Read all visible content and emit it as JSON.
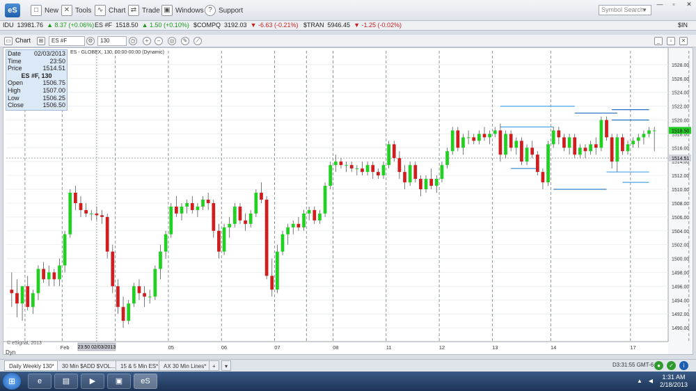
{
  "app": {
    "logo": "eS"
  },
  "menu": {
    "new": "New",
    "tools": "Tools",
    "chart": "Chart",
    "trade": "Trade",
    "windows": "Windows",
    "support": "Support",
    "search_placeholder": "Symbol Search"
  },
  "ticker": [
    {
      "symbol": "IDU",
      "price": "13981.76",
      "change": "8.37 (+0.06%)",
      "dir": "up"
    },
    {
      "symbol": "ES #F",
      "price": "1518.50",
      "change": "1.50 (+0.10%)",
      "dir": "up"
    },
    {
      "symbol": "$COMPQ",
      "price": "3192.03",
      "change": "-6.63 (-0.21%)",
      "dir": "down"
    },
    {
      "symbol": "$TRAN",
      "price": "5946.45",
      "change": "-1.25 (-0.02%)",
      "dir": "down"
    },
    {
      "symbol": "$IN",
      "price": "",
      "change": "",
      "dir": ""
    }
  ],
  "chart_toolbar": {
    "chart_label": "Chart",
    "symbol": "ES #F",
    "interval": "130"
  },
  "data_window": {
    "date_label": "Date",
    "date": "02/03/2013",
    "time_label": "Time",
    "time": "23:50",
    "price_label": "Price",
    "price": "1514.51",
    "title": "ES #F, 130",
    "open_label": "Open",
    "open": "1506.75",
    "high_label": "High",
    "high": "1507.00",
    "low_label": "Low",
    "low": "1506.25",
    "close_label": "Close",
    "close": "1506.50"
  },
  "study_label": "ES - GLOBEX, 130, 00:00-00:00 (Dynamic)",
  "watermark": "© eSignal, 2013",
  "cursor_date_label": "23:50 02/03/2013",
  "cursor_price_label": "1514.51",
  "last_price_label": "1518.50",
  "tabs": [
    "Daily Weekly 130*",
    "30 Min $ADD $VOL...*",
    "15 & 5 Min ES*",
    "AX 30 Min Lines*"
  ],
  "dyn_label": "Dyn",
  "status_time": "D3:31:55 GMT-6",
  "taskbar": {
    "time": "1:31 AM",
    "date": "2/18/2013",
    "es_label": "eS"
  },
  "colors": {
    "up": "#22d022",
    "down": "#d01e1e",
    "price_tag": "#22cc22",
    "levels": "#2a86d6"
  },
  "chart_data": {
    "type": "candlestick",
    "ylim": [
      1488,
      1530
    ],
    "yticks": [
      1490,
      1492,
      1494,
      1496,
      1498,
      1500,
      1502,
      1504,
      1506,
      1508,
      1510,
      1512,
      1514,
      1516,
      1518,
      1520,
      1522,
      1524,
      1526,
      1528
    ],
    "x_labels": [
      {
        "label": "Feb",
        "bar": 10
      },
      {
        "label": "05",
        "bar": 30
      },
      {
        "label": "06",
        "bar": 40
      },
      {
        "label": "07",
        "bar": 50
      },
      {
        "label": "08",
        "bar": 61
      },
      {
        "label": "11",
        "bar": 71
      },
      {
        "label": "12",
        "bar": 81
      },
      {
        "label": "13",
        "bar": 91
      },
      {
        "label": "14",
        "bar": 102
      },
      {
        "label": "17",
        "bar": 117
      }
    ],
    "candles": [
      {
        "o": 1495.5,
        "h": 1498.0,
        "l": 1493.0,
        "c": 1495.0
      },
      {
        "o": 1495.0,
        "h": 1497.0,
        "l": 1491.5,
        "c": 1493.5
      },
      {
        "o": 1493.5,
        "h": 1496.0,
        "l": 1491.0,
        "c": 1496.0
      },
      {
        "o": 1496.0,
        "h": 1497.5,
        "l": 1492.5,
        "c": 1493.0
      },
      {
        "o": 1493.0,
        "h": 1495.5,
        "l": 1492.0,
        "c": 1495.0
      },
      {
        "o": 1495.0,
        "h": 1499.0,
        "l": 1494.0,
        "c": 1498.5
      },
      {
        "o": 1498.5,
        "h": 1499.5,
        "l": 1496.5,
        "c": 1497.0
      },
      {
        "o": 1497.0,
        "h": 1499.0,
        "l": 1496.0,
        "c": 1498.0
      },
      {
        "o": 1498.0,
        "h": 1498.5,
        "l": 1496.0,
        "c": 1497.0
      },
      {
        "o": 1497.0,
        "h": 1500.0,
        "l": 1496.0,
        "c": 1499.0
      },
      {
        "o": 1499.0,
        "h": 1504.0,
        "l": 1498.0,
        "c": 1503.5
      },
      {
        "o": 1503.5,
        "h": 1510.0,
        "l": 1503.0,
        "c": 1509.5
      },
      {
        "o": 1509.5,
        "h": 1510.5,
        "l": 1507.0,
        "c": 1508.0
      },
      {
        "o": 1508.0,
        "h": 1509.0,
        "l": 1506.0,
        "c": 1507.0
      },
      {
        "o": 1507.0,
        "h": 1508.0,
        "l": 1506.0,
        "c": 1506.5
      },
      {
        "o": 1506.5,
        "h": 1507.0,
        "l": 1505.5,
        "c": 1506.5
      },
      {
        "o": 1506.5,
        "h": 1507.5,
        "l": 1505.5,
        "c": 1506.25
      },
      {
        "o": 1506.25,
        "h": 1507.0,
        "l": 1505.0,
        "c": 1506.0
      },
      {
        "o": 1506.0,
        "h": 1506.5,
        "l": 1500.0,
        "c": 1501.0
      },
      {
        "o": 1501.0,
        "h": 1502.0,
        "l": 1495.0,
        "c": 1496.0
      },
      {
        "o": 1496.0,
        "h": 1497.0,
        "l": 1492.0,
        "c": 1493.0
      },
      {
        "o": 1493.0,
        "h": 1494.5,
        "l": 1490.0,
        "c": 1491.0
      },
      {
        "o": 1491.0,
        "h": 1494.0,
        "l": 1490.5,
        "c": 1493.5
      },
      {
        "o": 1493.5,
        "h": 1496.5,
        "l": 1493.0,
        "c": 1496.0
      },
      {
        "o": 1496.0,
        "h": 1497.0,
        "l": 1494.0,
        "c": 1495.0
      },
      {
        "o": 1495.0,
        "h": 1496.0,
        "l": 1493.0,
        "c": 1494.5
      },
      {
        "o": 1494.5,
        "h": 1495.5,
        "l": 1493.5,
        "c": 1494.5
      },
      {
        "o": 1494.5,
        "h": 1499.0,
        "l": 1494.0,
        "c": 1498.5
      },
      {
        "o": 1498.5,
        "h": 1502.0,
        "l": 1497.0,
        "c": 1501.0
      },
      {
        "o": 1501.0,
        "h": 1504.0,
        "l": 1500.0,
        "c": 1503.5
      },
      {
        "o": 1503.5,
        "h": 1508.0,
        "l": 1503.0,
        "c": 1507.5
      },
      {
        "o": 1507.5,
        "h": 1509.0,
        "l": 1506.0,
        "c": 1506.5
      },
      {
        "o": 1506.5,
        "h": 1508.0,
        "l": 1505.5,
        "c": 1507.5
      },
      {
        "o": 1507.5,
        "h": 1508.5,
        "l": 1506.5,
        "c": 1508.0
      },
      {
        "o": 1508.0,
        "h": 1509.0,
        "l": 1506.5,
        "c": 1507.0
      },
      {
        "o": 1507.0,
        "h": 1508.0,
        "l": 1506.0,
        "c": 1507.5
      },
      {
        "o": 1507.5,
        "h": 1509.0,
        "l": 1507.0,
        "c": 1508.5
      },
      {
        "o": 1508.5,
        "h": 1509.5,
        "l": 1507.0,
        "c": 1508.0
      },
      {
        "o": 1508.0,
        "h": 1508.5,
        "l": 1503.0,
        "c": 1504.0
      },
      {
        "o": 1504.0,
        "h": 1505.0,
        "l": 1500.0,
        "c": 1501.0
      },
      {
        "o": 1501.0,
        "h": 1505.0,
        "l": 1500.5,
        "c": 1504.5
      },
      {
        "o": 1504.5,
        "h": 1506.0,
        "l": 1503.0,
        "c": 1505.0
      },
      {
        "o": 1505.0,
        "h": 1508.0,
        "l": 1504.5,
        "c": 1507.5
      },
      {
        "o": 1507.5,
        "h": 1508.0,
        "l": 1505.0,
        "c": 1505.5
      },
      {
        "o": 1505.5,
        "h": 1506.5,
        "l": 1504.0,
        "c": 1505.0
      },
      {
        "o": 1505.0,
        "h": 1507.0,
        "l": 1504.5,
        "c": 1506.5
      },
      {
        "o": 1506.5,
        "h": 1510.0,
        "l": 1506.0,
        "c": 1509.5
      },
      {
        "o": 1509.5,
        "h": 1511.0,
        "l": 1508.0,
        "c": 1508.5
      },
      {
        "o": 1508.5,
        "h": 1509.0,
        "l": 1497.0,
        "c": 1497.5
      },
      {
        "o": 1497.5,
        "h": 1500.0,
        "l": 1494.5,
        "c": 1495.5
      },
      {
        "o": 1495.5,
        "h": 1502.0,
        "l": 1495.0,
        "c": 1501.0
      },
      {
        "o": 1501.0,
        "h": 1504.0,
        "l": 1500.5,
        "c": 1503.5
      },
      {
        "o": 1503.5,
        "h": 1505.0,
        "l": 1502.0,
        "c": 1504.5
      },
      {
        "o": 1504.5,
        "h": 1505.5,
        "l": 1503.5,
        "c": 1505.0
      },
      {
        "o": 1505.0,
        "h": 1506.0,
        "l": 1504.0,
        "c": 1504.5
      },
      {
        "o": 1504.5,
        "h": 1507.0,
        "l": 1504.0,
        "c": 1506.5
      },
      {
        "o": 1506.5,
        "h": 1507.5,
        "l": 1505.5,
        "c": 1507.0
      },
      {
        "o": 1507.0,
        "h": 1507.5,
        "l": 1505.0,
        "c": 1505.5
      },
      {
        "o": 1505.5,
        "h": 1507.0,
        "l": 1505.0,
        "c": 1506.5
      },
      {
        "o": 1506.5,
        "h": 1511.0,
        "l": 1506.0,
        "c": 1510.5
      },
      {
        "o": 1510.5,
        "h": 1514.0,
        "l": 1510.0,
        "c": 1513.5
      },
      {
        "o": 1513.5,
        "h": 1515.0,
        "l": 1512.5,
        "c": 1514.0
      },
      {
        "o": 1514.0,
        "h": 1514.5,
        "l": 1513.0,
        "c": 1513.5
      },
      {
        "o": 1513.5,
        "h": 1514.0,
        "l": 1512.5,
        "c": 1513.5
      },
      {
        "o": 1513.5,
        "h": 1514.0,
        "l": 1512.5,
        "c": 1513.0
      },
      {
        "o": 1513.0,
        "h": 1513.5,
        "l": 1512.0,
        "c": 1513.0
      },
      {
        "o": 1513.0,
        "h": 1514.0,
        "l": 1512.0,
        "c": 1512.5
      },
      {
        "o": 1512.5,
        "h": 1514.0,
        "l": 1512.0,
        "c": 1513.5
      },
      {
        "o": 1513.5,
        "h": 1514.0,
        "l": 1511.5,
        "c": 1512.5
      },
      {
        "o": 1512.5,
        "h": 1513.0,
        "l": 1511.5,
        "c": 1512.0
      },
      {
        "o": 1512.0,
        "h": 1514.0,
        "l": 1511.5,
        "c": 1513.5
      },
      {
        "o": 1513.5,
        "h": 1517.0,
        "l": 1513.0,
        "c": 1516.5
      },
      {
        "o": 1516.5,
        "h": 1517.0,
        "l": 1514.0,
        "c": 1514.5
      },
      {
        "o": 1514.5,
        "h": 1515.5,
        "l": 1511.5,
        "c": 1512.5
      },
      {
        "o": 1512.5,
        "h": 1513.5,
        "l": 1510.0,
        "c": 1511.0
      },
      {
        "o": 1511.0,
        "h": 1514.0,
        "l": 1510.5,
        "c": 1513.5
      },
      {
        "o": 1513.5,
        "h": 1514.0,
        "l": 1511.0,
        "c": 1511.5
      },
      {
        "o": 1511.5,
        "h": 1512.0,
        "l": 1509.0,
        "c": 1510.0
      },
      {
        "o": 1510.0,
        "h": 1512.0,
        "l": 1509.5,
        "c": 1511.5
      },
      {
        "o": 1511.5,
        "h": 1513.0,
        "l": 1510.0,
        "c": 1510.5
      },
      {
        "o": 1510.5,
        "h": 1512.0,
        "l": 1509.5,
        "c": 1511.5
      },
      {
        "o": 1511.5,
        "h": 1514.0,
        "l": 1511.0,
        "c": 1513.5
      },
      {
        "o": 1513.5,
        "h": 1516.0,
        "l": 1513.0,
        "c": 1515.5
      },
      {
        "o": 1515.5,
        "h": 1519.0,
        "l": 1515.0,
        "c": 1518.5
      },
      {
        "o": 1518.5,
        "h": 1519.0,
        "l": 1515.5,
        "c": 1516.0
      },
      {
        "o": 1516.0,
        "h": 1518.0,
        "l": 1515.0,
        "c": 1517.5
      },
      {
        "o": 1517.5,
        "h": 1518.5,
        "l": 1516.5,
        "c": 1517.5
      },
      {
        "o": 1517.5,
        "h": 1518.0,
        "l": 1516.5,
        "c": 1517.0
      },
      {
        "o": 1517.0,
        "h": 1518.5,
        "l": 1516.5,
        "c": 1518.0
      },
      {
        "o": 1518.0,
        "h": 1519.0,
        "l": 1517.0,
        "c": 1517.5
      },
      {
        "o": 1517.5,
        "h": 1518.5,
        "l": 1516.5,
        "c": 1518.0
      },
      {
        "o": 1518.0,
        "h": 1519.0,
        "l": 1517.5,
        "c": 1518.5
      },
      {
        "o": 1518.5,
        "h": 1519.5,
        "l": 1514.0,
        "c": 1515.0
      },
      {
        "o": 1515.0,
        "h": 1518.5,
        "l": 1514.5,
        "c": 1518.0
      },
      {
        "o": 1518.0,
        "h": 1518.5,
        "l": 1515.5,
        "c": 1516.0
      },
      {
        "o": 1516.0,
        "h": 1517.5,
        "l": 1515.0,
        "c": 1517.0
      },
      {
        "o": 1517.0,
        "h": 1517.5,
        "l": 1513.5,
        "c": 1514.0
      },
      {
        "o": 1514.0,
        "h": 1516.5,
        "l": 1513.5,
        "c": 1516.0
      },
      {
        "o": 1516.0,
        "h": 1517.0,
        "l": 1514.5,
        "c": 1515.0
      },
      {
        "o": 1515.0,
        "h": 1515.5,
        "l": 1512.0,
        "c": 1512.5
      },
      {
        "o": 1512.5,
        "h": 1513.0,
        "l": 1510.0,
        "c": 1511.0
      },
      {
        "o": 1511.0,
        "h": 1517.0,
        "l": 1510.5,
        "c": 1516.5
      },
      {
        "o": 1516.5,
        "h": 1519.0,
        "l": 1516.0,
        "c": 1518.5
      },
      {
        "o": 1518.5,
        "h": 1519.0,
        "l": 1516.5,
        "c": 1517.5
      },
      {
        "o": 1517.5,
        "h": 1518.0,
        "l": 1515.5,
        "c": 1516.0
      },
      {
        "o": 1516.0,
        "h": 1518.0,
        "l": 1515.0,
        "c": 1517.5
      },
      {
        "o": 1517.5,
        "h": 1518.0,
        "l": 1514.5,
        "c": 1515.0
      },
      {
        "o": 1515.0,
        "h": 1516.5,
        "l": 1514.5,
        "c": 1516.0
      },
      {
        "o": 1516.0,
        "h": 1516.5,
        "l": 1514.5,
        "c": 1515.5
      },
      {
        "o": 1515.5,
        "h": 1517.0,
        "l": 1515.0,
        "c": 1516.5
      },
      {
        "o": 1516.5,
        "h": 1517.5,
        "l": 1515.0,
        "c": 1516.0
      },
      {
        "o": 1516.0,
        "h": 1520.5,
        "l": 1515.5,
        "c": 1520.0
      },
      {
        "o": 1520.0,
        "h": 1520.5,
        "l": 1517.0,
        "c": 1517.5
      },
      {
        "o": 1517.5,
        "h": 1518.0,
        "l": 1513.0,
        "c": 1514.0
      },
      {
        "o": 1514.0,
        "h": 1518.0,
        "l": 1512.5,
        "c": 1517.5
      },
      {
        "o": 1517.5,
        "h": 1518.0,
        "l": 1515.0,
        "c": 1515.5
      },
      {
        "o": 1515.5,
        "h": 1517.0,
        "l": 1515.0,
        "c": 1516.5
      },
      {
        "o": 1516.5,
        "h": 1517.5,
        "l": 1516.0,
        "c": 1517.0
      },
      {
        "o": 1517.0,
        "h": 1518.0,
        "l": 1516.0,
        "c": 1517.5
      },
      {
        "o": 1517.5,
        "h": 1518.5,
        "l": 1516.5,
        "c": 1518.0
      },
      {
        "o": 1518.0,
        "h": 1519.0,
        "l": 1517.5,
        "c": 1518.5
      },
      {
        "o": 1518.5,
        "h": 1519.0,
        "l": 1515.5,
        "c": 1518.5
      }
    ],
    "session_lines_bars": [
      3,
      10,
      20,
      30,
      40,
      50,
      56,
      61,
      71,
      81,
      91,
      102,
      117,
      128
    ],
    "levels": [
      {
        "price": 1522.0,
        "from": 92,
        "to": 106,
        "color": "#4aa3e6"
      },
      {
        "price": 1519.0,
        "from": 92,
        "to": 102,
        "color": "#4aa3e6"
      },
      {
        "price": 1513.0,
        "from": 94,
        "to": 99,
        "color": "#2a86d6"
      },
      {
        "price": 1521.0,
        "from": 106,
        "to": 114,
        "color": "#1a6fc4"
      },
      {
        "price": 1510.0,
        "from": 102,
        "to": 112,
        "color": "#1a6fc4"
      },
      {
        "price": 1521.5,
        "from": 113,
        "to": 120,
        "color": "#1a6fc4"
      },
      {
        "price": 1520.0,
        "from": 113,
        "to": 120,
        "color": "#1a6fc4"
      },
      {
        "price": 1512.5,
        "from": 112,
        "to": 120,
        "color": "#4aa3e6"
      },
      {
        "price": 1511.0,
        "from": 115,
        "to": 120,
        "color": "#4aa3e6"
      }
    ],
    "last_price": 1518.5,
    "cursor_price": 1514.51,
    "cursor_bar": 16
  }
}
